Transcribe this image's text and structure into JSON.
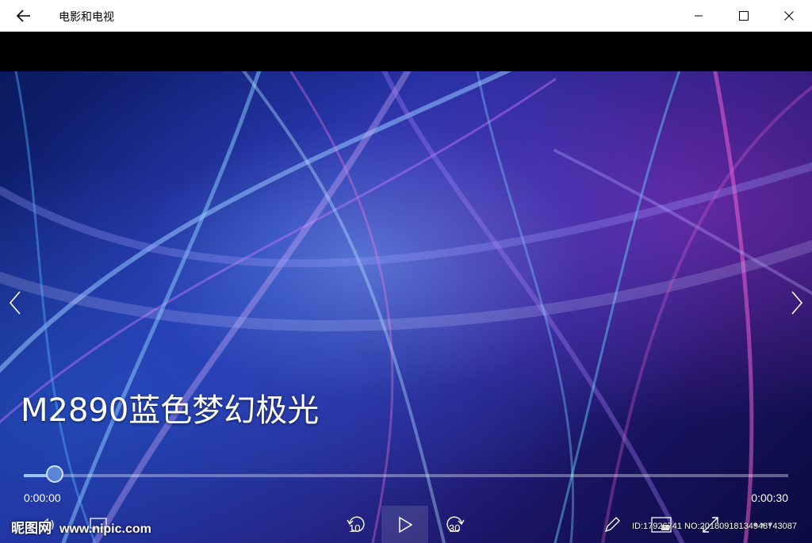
{
  "titlebar": {
    "app_title": "电影和电视",
    "icons": {
      "back": "back-arrow-icon",
      "minimize": "minimize-icon",
      "maximize": "maximize-icon",
      "close": "close-icon"
    }
  },
  "player": {
    "video_title": "M2890蓝色梦幻极光",
    "current_time": "0:00:00",
    "total_time": "0:00:30",
    "progress": 0.04,
    "skip_back_seconds": "10",
    "skip_forward_seconds": "30",
    "icons": {
      "prev": "chevron-left-icon",
      "next": "chevron-right-icon",
      "volume": "volume-icon",
      "subtitles": "subtitles-icon",
      "skip_back": "skip-back-icon",
      "play": "play-icon",
      "skip_forward": "skip-forward-icon",
      "edit": "pencil-icon",
      "mini_view": "mini-view-icon",
      "fullscreen": "fullscreen-icon",
      "more": "more-icon"
    }
  },
  "watermark": {
    "brand": "昵图网",
    "site": "www.nipic.com",
    "id_text": "ID:17926741 NO:20180918134948743087"
  },
  "colors": {
    "titlebar_bg": "#ffffff",
    "accent": "#9ec3ff"
  }
}
